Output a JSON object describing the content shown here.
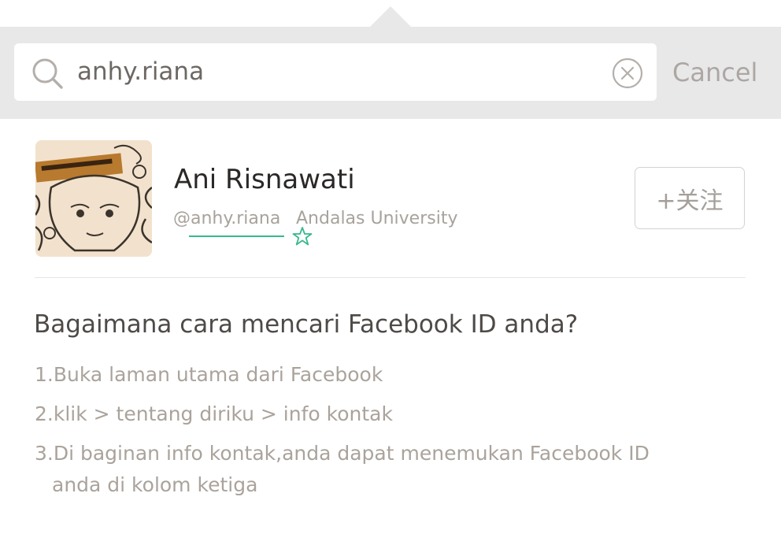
{
  "search": {
    "value": "anhy.riana",
    "cancel_label": "Cancel"
  },
  "result": {
    "name": "Ani Risnawati",
    "handle": "@anhy.riana",
    "school": "Andalas University",
    "follow_label": "+关注"
  },
  "help": {
    "title": "Bagaimana cara mencari Facebook ID anda?",
    "steps": [
      "1.Buka laman utama dari Facebook",
      "2.klik > tentang diriku > info kontak"
    ],
    "step3_line1": "3.Di baginan info kontak,anda dapat menemukan Facebook ID",
    "step3_line2": "anda di kolom ketiga"
  },
  "icons": {
    "search": "search-icon",
    "clear": "clear-icon",
    "star": "star-icon"
  },
  "colors": {
    "accent": "#39b88f",
    "search_bar_bg": "#e9e8e9",
    "text_muted": "#aaa39c"
  }
}
